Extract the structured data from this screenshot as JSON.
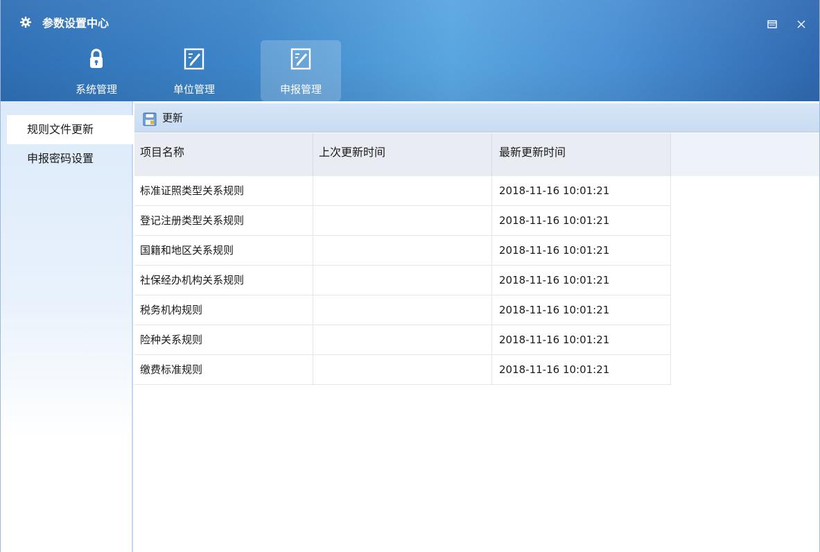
{
  "window": {
    "title": "参数设置中心",
    "accent_color": "#3d86c9"
  },
  "nav": {
    "items": [
      {
        "label": "系统管理",
        "icon": "lock-icon",
        "active": false
      },
      {
        "label": "单位管理",
        "icon": "edit-form-icon",
        "active": false
      },
      {
        "label": "申报管理",
        "icon": "edit-form-icon",
        "active": true
      }
    ]
  },
  "sidebar": {
    "items": [
      {
        "label": "规则文件更新",
        "active": true
      },
      {
        "label": "申报密码设置",
        "active": false
      }
    ]
  },
  "toolbar": {
    "update_label": "更新",
    "update_icon": "save-disk-icon"
  },
  "grid": {
    "columns": [
      "项目名称",
      "上次更新时间",
      "最新更新时间"
    ],
    "rows": [
      {
        "name": "标准证照类型关系规则",
        "last": "",
        "latest": "2018-11-16 10:01:21"
      },
      {
        "name": "登记注册类型关系规则",
        "last": "",
        "latest": "2018-11-16 10:01:21"
      },
      {
        "name": "国籍和地区关系规则",
        "last": "",
        "latest": "2018-11-16 10:01:21"
      },
      {
        "name": "社保经办机构关系规则",
        "last": "",
        "latest": "2018-11-16 10:01:21"
      },
      {
        "name": "税务机构规则",
        "last": "",
        "latest": "2018-11-16 10:01:21"
      },
      {
        "name": "险种关系规则",
        "last": "",
        "latest": "2018-11-16 10:01:21"
      },
      {
        "name": "缴费标准规则",
        "last": "",
        "latest": "2018-11-16 10:01:21"
      }
    ]
  }
}
